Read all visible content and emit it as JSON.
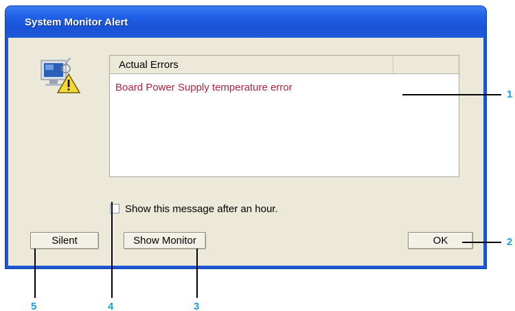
{
  "window": {
    "title": "System Monitor Alert"
  },
  "errors_list": {
    "column_header": "Actual Errors",
    "items": [
      "Board Power Supply temperature error"
    ]
  },
  "options": {
    "show_later_label": "Show this message after an hour.",
    "show_later_checked": false
  },
  "buttons": {
    "silent": "Silent",
    "show_monitor": "Show Monitor",
    "ok": "OK"
  },
  "callouts": [
    "1",
    "2",
    "3",
    "4",
    "5"
  ],
  "colors": {
    "title_bar": "#1f5fe6",
    "error_text": "#b0233a",
    "callout": "#1a9fd6",
    "dialog_bg": "#ece9d8"
  }
}
